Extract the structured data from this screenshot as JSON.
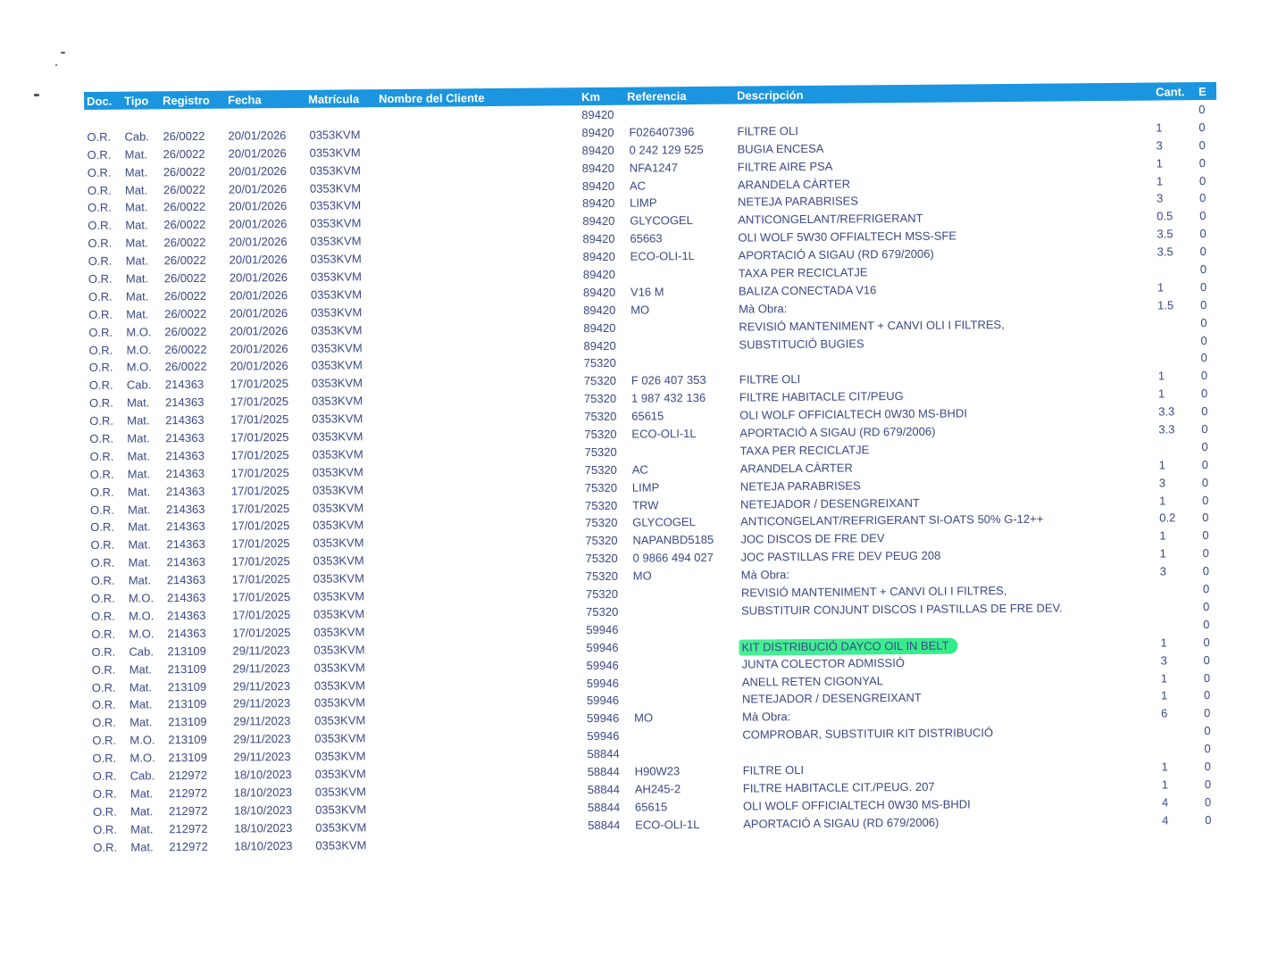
{
  "headers": {
    "doc": "Doc.",
    "tipo": "Tipo",
    "registro": "Registro",
    "fecha": "Fecha",
    "matricula": "Matrícula",
    "nombre": "Nombre del Cliente",
    "km": "Km",
    "referencia": "Referencia",
    "descripcion": "Descripción",
    "cant": "Cant.",
    "e": "E"
  },
  "colors": {
    "header_bg": "#1b95e0",
    "text": "#3b4a86",
    "highlight": "#29eb83"
  },
  "rows": [
    {
      "doc": "",
      "tipo": "",
      "registro": "",
      "fecha": "",
      "matricula": "",
      "km": "89420",
      "ref": "",
      "desc": "",
      "cant": "",
      "e": "0"
    },
    {
      "doc": "O.R.",
      "tipo": "Cab.",
      "registro": "26/0022",
      "fecha": "20/01/2026",
      "matricula": "0353KVM",
      "km": "89420",
      "ref": "F026407396",
      "desc": "FILTRE OLI",
      "cant": "1",
      "e": "0"
    },
    {
      "doc": "O.R.",
      "tipo": "Mat.",
      "registro": "26/0022",
      "fecha": "20/01/2026",
      "matricula": "0353KVM",
      "km": "89420",
      "ref": "0 242 129 525",
      "desc": "BUGIA ENCESA",
      "cant": "3",
      "e": "0"
    },
    {
      "doc": "O.R.",
      "tipo": "Mat.",
      "registro": "26/0022",
      "fecha": "20/01/2026",
      "matricula": "0353KVM",
      "km": "89420",
      "ref": "NFA1247",
      "desc": "FILTRE AIRE PSA",
      "cant": "1",
      "e": "0"
    },
    {
      "doc": "O.R.",
      "tipo": "Mat.",
      "registro": "26/0022",
      "fecha": "20/01/2026",
      "matricula": "0353KVM",
      "km": "89420",
      "ref": "AC",
      "desc": "ARANDELA CÀRTER",
      "cant": "1",
      "e": "0"
    },
    {
      "doc": "O.R.",
      "tipo": "Mat.",
      "registro": "26/0022",
      "fecha": "20/01/2026",
      "matricula": "0353KVM",
      "km": "89420",
      "ref": "LIMP",
      "desc": "NETEJA PARABRISES",
      "cant": "3",
      "e": "0"
    },
    {
      "doc": "O.R.",
      "tipo": "Mat.",
      "registro": "26/0022",
      "fecha": "20/01/2026",
      "matricula": "0353KVM",
      "km": "89420",
      "ref": "GLYCOGEL",
      "desc": "ANTICONGELANT/REFRIGERANT",
      "cant": "0.5",
      "e": "0"
    },
    {
      "doc": "O.R.",
      "tipo": "Mat.",
      "registro": "26/0022",
      "fecha": "20/01/2026",
      "matricula": "0353KVM",
      "km": "89420",
      "ref": "65663",
      "desc": "OLI WOLF 5W30 OFFIALTECH MSS-SFE",
      "cant": "3.5",
      "e": "0"
    },
    {
      "doc": "O.R.",
      "tipo": "Mat.",
      "registro": "26/0022",
      "fecha": "20/01/2026",
      "matricula": "0353KVM",
      "km": "89420",
      "ref": "ECO-OLI-1L",
      "desc": "APORTACIÓ A SIGAU  (RD 679/2006)",
      "cant": "3.5",
      "e": "0"
    },
    {
      "doc": "O.R.",
      "tipo": "Mat.",
      "registro": "26/0022",
      "fecha": "20/01/2026",
      "matricula": "0353KVM",
      "km": "89420",
      "ref": "",
      "desc": "TAXA PER RECICLATJE",
      "cant": "",
      "e": "0"
    },
    {
      "doc": "O.R.",
      "tipo": "Mat.",
      "registro": "26/0022",
      "fecha": "20/01/2026",
      "matricula": "0353KVM",
      "km": "89420",
      "ref": "V16 M",
      "desc": "BALIZA CONECTADA V16",
      "cant": "1",
      "e": "0"
    },
    {
      "doc": "O.R.",
      "tipo": "Mat.",
      "registro": "26/0022",
      "fecha": "20/01/2026",
      "matricula": "0353KVM",
      "km": "89420",
      "ref": "MO",
      "desc": "Mà Obra:",
      "cant": "1.5",
      "e": "0"
    },
    {
      "doc": "O.R.",
      "tipo": "M.O.",
      "registro": "26/0022",
      "fecha": "20/01/2026",
      "matricula": "0353KVM",
      "km": "89420",
      "ref": "",
      "desc": "REVISIÓ MANTENIMENT + CANVI OLI I FILTRES,",
      "cant": "",
      "e": "0"
    },
    {
      "doc": "O.R.",
      "tipo": "M.O.",
      "registro": "26/0022",
      "fecha": "20/01/2026",
      "matricula": "0353KVM",
      "km": "89420",
      "ref": "",
      "desc": "SUBSTITUCIÓ BUGIES",
      "cant": "",
      "e": "0"
    },
    {
      "doc": "O.R.",
      "tipo": "M.O.",
      "registro": "26/0022",
      "fecha": "20/01/2026",
      "matricula": "0353KVM",
      "km": "75320",
      "ref": "",
      "desc": "",
      "cant": "",
      "e": "0"
    },
    {
      "doc": "O.R.",
      "tipo": "Cab.",
      "registro": "214363",
      "fecha": "17/01/2025",
      "matricula": "0353KVM",
      "km": "75320",
      "ref": "F 026 407 353",
      "desc": "FILTRE OLI",
      "cant": "1",
      "e": "0"
    },
    {
      "doc": "O.R.",
      "tipo": "Mat.",
      "registro": "214363",
      "fecha": "17/01/2025",
      "matricula": "0353KVM",
      "km": "75320",
      "ref": "1 987 432 136",
      "desc": "FILTRE HABITACLE CIT/PEUG",
      "cant": "1",
      "e": "0"
    },
    {
      "doc": "O.R.",
      "tipo": "Mat.",
      "registro": "214363",
      "fecha": "17/01/2025",
      "matricula": "0353KVM",
      "km": "75320",
      "ref": "65615",
      "desc": "OLI WOLF OFFICIALTECH 0W30  MS-BHDI",
      "cant": "3.3",
      "e": "0"
    },
    {
      "doc": "O.R.",
      "tipo": "Mat.",
      "registro": "214363",
      "fecha": "17/01/2025",
      "matricula": "0353KVM",
      "km": "75320",
      "ref": "ECO-OLI-1L",
      "desc": "APORTACIÓ A SIGAU  (RD 679/2006)",
      "cant": "3.3",
      "e": "0"
    },
    {
      "doc": "O.R.",
      "tipo": "Mat.",
      "registro": "214363",
      "fecha": "17/01/2025",
      "matricula": "0353KVM",
      "km": "75320",
      "ref": "",
      "desc": "TAXA PER RECICLATJE",
      "cant": "",
      "e": "0"
    },
    {
      "doc": "O.R.",
      "tipo": "Mat.",
      "registro": "214363",
      "fecha": "17/01/2025",
      "matricula": "0353KVM",
      "km": "75320",
      "ref": "AC",
      "desc": "ARANDELA CÀRTER",
      "cant": "1",
      "e": "0"
    },
    {
      "doc": "O.R.",
      "tipo": "Mat.",
      "registro": "214363",
      "fecha": "17/01/2025",
      "matricula": "0353KVM",
      "km": "75320",
      "ref": "LIMP",
      "desc": "NETEJA PARABRISES",
      "cant": "3",
      "e": "0"
    },
    {
      "doc": "O.R.",
      "tipo": "Mat.",
      "registro": "214363",
      "fecha": "17/01/2025",
      "matricula": "0353KVM",
      "km": "75320",
      "ref": "TRW",
      "desc": "NETEJADOR / DESENGREIXANT",
      "cant": "1",
      "e": "0"
    },
    {
      "doc": "O.R.",
      "tipo": "Mat.",
      "registro": "214363",
      "fecha": "17/01/2025",
      "matricula": "0353KVM",
      "km": "75320",
      "ref": "GLYCOGEL",
      "desc": "ANTICONGELANT/REFRIGERANT SI-OATS 50% G-12++",
      "cant": "0.2",
      "e": "0"
    },
    {
      "doc": "O.R.",
      "tipo": "Mat.",
      "registro": "214363",
      "fecha": "17/01/2025",
      "matricula": "0353KVM",
      "km": "75320",
      "ref": "NAPANBD5185",
      "desc": "JOC DISCOS DE FRE DEV",
      "cant": "1",
      "e": "0"
    },
    {
      "doc": "O.R.",
      "tipo": "Mat.",
      "registro": "214363",
      "fecha": "17/01/2025",
      "matricula": "0353KVM",
      "km": "75320",
      "ref": "0 9866 494 027",
      "desc": "JOC PASTILLAS FRE DEV PEUG 208",
      "cant": "1",
      "e": "0"
    },
    {
      "doc": "O.R.",
      "tipo": "Mat.",
      "registro": "214363",
      "fecha": "17/01/2025",
      "matricula": "0353KVM",
      "km": "75320",
      "ref": "MO",
      "desc": "Mà Obra:",
      "cant": "3",
      "e": "0"
    },
    {
      "doc": "O.R.",
      "tipo": "M.O.",
      "registro": "214363",
      "fecha": "17/01/2025",
      "matricula": "0353KVM",
      "km": "75320",
      "ref": "",
      "desc": "REVISIÓ MANTENIMENT + CANVI OLI I FILTRES,",
      "cant": "",
      "e": "0"
    },
    {
      "doc": "O.R.",
      "tipo": "M.O.",
      "registro": "214363",
      "fecha": "17/01/2025",
      "matricula": "0353KVM",
      "km": "75320",
      "ref": "",
      "desc": "SUBSTITUIR CONJUNT DISCOS I PASTILLAS DE FRE DEV.",
      "cant": "",
      "e": "0"
    },
    {
      "doc": "O.R.",
      "tipo": "M.O.",
      "registro": "214363",
      "fecha": "17/01/2025",
      "matricula": "0353KVM",
      "km": "59946",
      "ref": "",
      "desc": "",
      "cant": "",
      "e": "0"
    },
    {
      "doc": "O.R.",
      "tipo": "Cab.",
      "registro": "213109",
      "fecha": "29/11/2023",
      "matricula": "0353KVM",
      "km": "59946",
      "ref": "",
      "desc": "KIT DISTRIBUCIÓ DAYCO OIL IN BELT",
      "cant": "1",
      "e": "0",
      "highlight": true
    },
    {
      "doc": "O.R.",
      "tipo": "Mat.",
      "registro": "213109",
      "fecha": "29/11/2023",
      "matricula": "0353KVM",
      "km": "59946",
      "ref": "",
      "desc": "JUNTA COLECTOR ADMISSIÓ",
      "cant": "3",
      "e": "0"
    },
    {
      "doc": "O.R.",
      "tipo": "Mat.",
      "registro": "213109",
      "fecha": "29/11/2023",
      "matricula": "0353KVM",
      "km": "59946",
      "ref": "",
      "desc": "ANELL RETEN CIGONYAL",
      "cant": "1",
      "e": "0"
    },
    {
      "doc": "O.R.",
      "tipo": "Mat.",
      "registro": "213109",
      "fecha": "29/11/2023",
      "matricula": "0353KVM",
      "km": "59946",
      "ref": "",
      "desc": "NETEJADOR / DESENGREIXANT",
      "cant": "1",
      "e": "0"
    },
    {
      "doc": "O.R.",
      "tipo": "Mat.",
      "registro": "213109",
      "fecha": "29/11/2023",
      "matricula": "0353KVM",
      "km": "59946",
      "ref": "MO",
      "desc": "Mà Obra:",
      "cant": "6",
      "e": "0"
    },
    {
      "doc": "O.R.",
      "tipo": "M.O.",
      "registro": "213109",
      "fecha": "29/11/2023",
      "matricula": "0353KVM",
      "km": "59946",
      "ref": "",
      "desc": "COMPROBAR, SUBSTITUIR KIT DISTRIBUCIÓ",
      "cant": "",
      "e": "0"
    },
    {
      "doc": "O.R.",
      "tipo": "M.O.",
      "registro": "213109",
      "fecha": "29/11/2023",
      "matricula": "0353KVM",
      "km": "58844",
      "ref": "",
      "desc": "",
      "cant": "",
      "e": "0"
    },
    {
      "doc": "O.R.",
      "tipo": "Cab.",
      "registro": "212972",
      "fecha": "18/10/2023",
      "matricula": "0353KVM",
      "km": "58844",
      "ref": "H90W23",
      "desc": "FILTRE OLI",
      "cant": "1",
      "e": "0"
    },
    {
      "doc": "O.R.",
      "tipo": "Mat.",
      "registro": "212972",
      "fecha": "18/10/2023",
      "matricula": "0353KVM",
      "km": "58844",
      "ref": "AH245-2",
      "desc": "FILTRE HABITACLE CIT./PEUG. 207",
      "cant": "1",
      "e": "0"
    },
    {
      "doc": "O.R.",
      "tipo": "Mat.",
      "registro": "212972",
      "fecha": "18/10/2023",
      "matricula": "0353KVM",
      "km": "58844",
      "ref": "65615",
      "desc": "OLI WOLF OFFICIALTECH 0W30  MS-BHDI",
      "cant": "4",
      "e": "0"
    },
    {
      "doc": "O.R.",
      "tipo": "Mat.",
      "registro": "212972",
      "fecha": "18/10/2023",
      "matricula": "0353KVM",
      "km": "58844",
      "ref": "ECO-OLI-1L",
      "desc": "APORTACIÓ A SIGAU  (RD 679/2006)",
      "cant": "4",
      "e": "0"
    },
    {
      "doc": "O.R.",
      "tipo": "Mat.",
      "registro": "212972",
      "fecha": "18/10/2023",
      "matricula": "0353KVM",
      "km": "",
      "ref": "",
      "desc": "",
      "cant": "",
      "e": ""
    }
  ]
}
